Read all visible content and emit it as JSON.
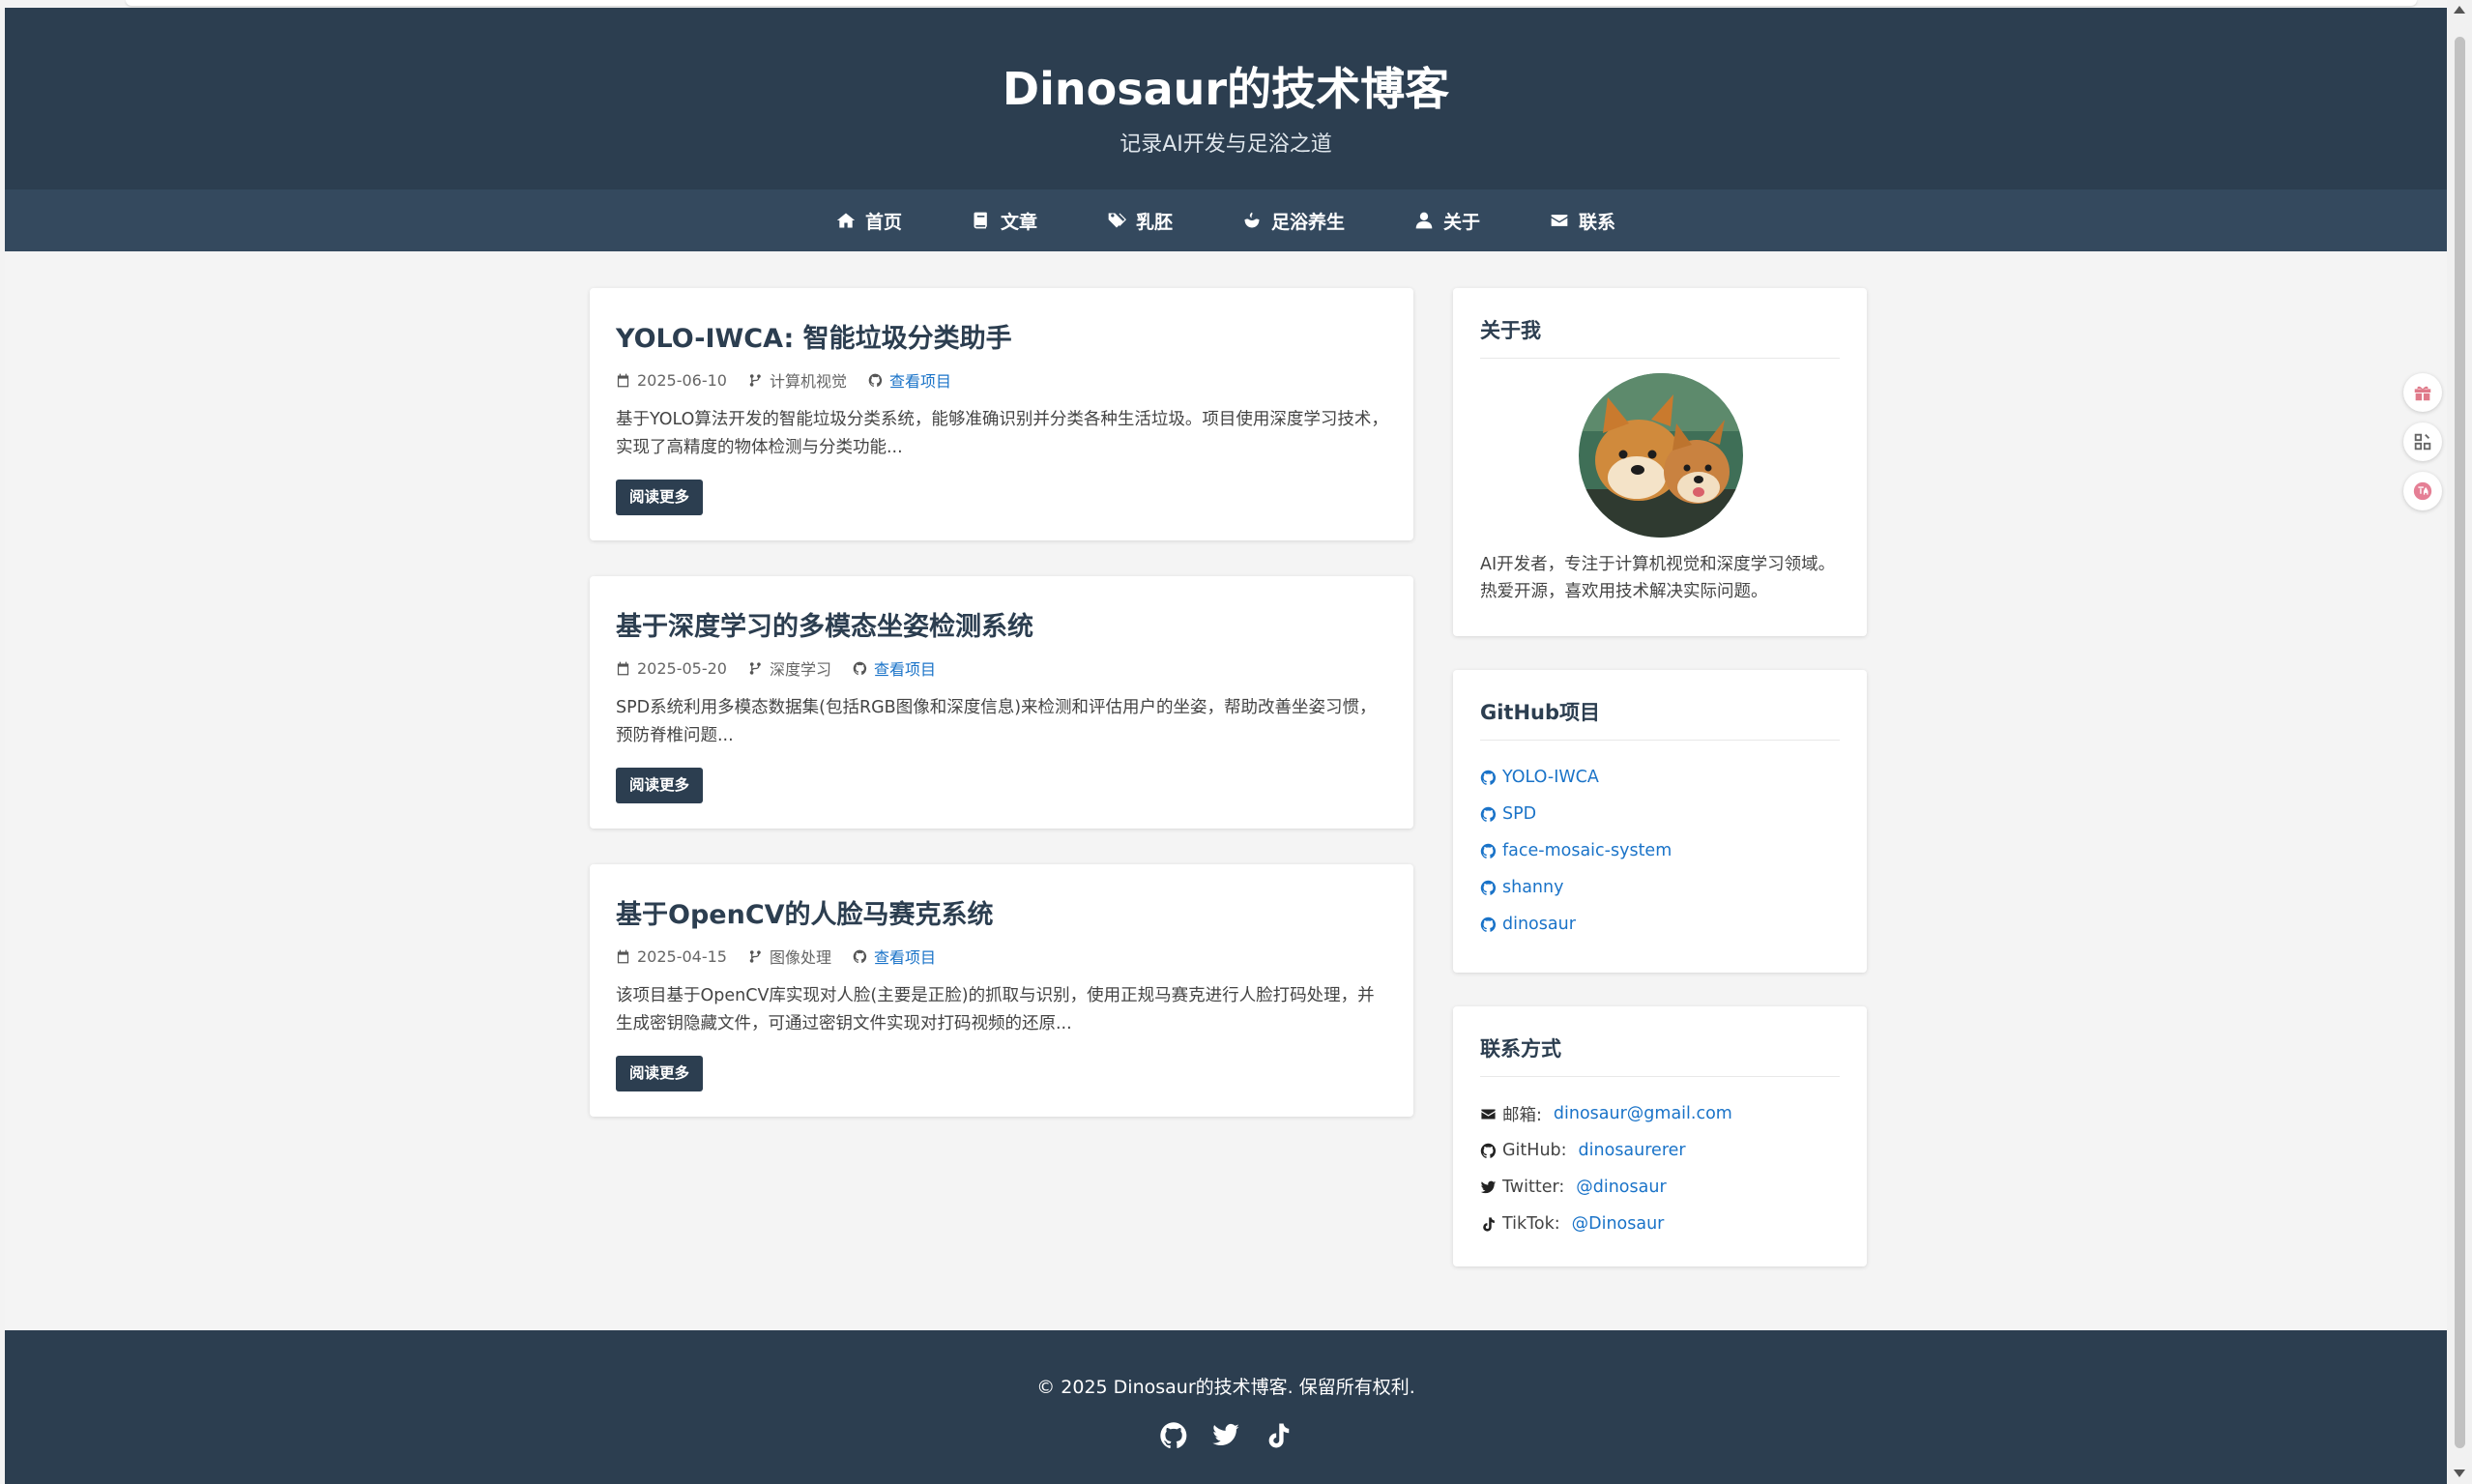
{
  "header": {
    "title": "Dinosaur的技术博客",
    "subtitle": "记录AI开发与足浴之道"
  },
  "nav": [
    {
      "label": "首页",
      "icon": "home-icon"
    },
    {
      "label": "文章",
      "icon": "book-icon"
    },
    {
      "label": "乳胚",
      "icon": "tags-icon"
    },
    {
      "label": "足浴养生",
      "icon": "foot-bath-icon"
    },
    {
      "label": "关于",
      "icon": "user-icon"
    },
    {
      "label": "联系",
      "icon": "envelope-icon"
    }
  ],
  "posts": [
    {
      "title": "YOLO-IWCA: 智能垃圾分类助手",
      "date": "2025-06-10",
      "category": "计算机视觉",
      "project_link": "查看项目",
      "excerpt": "基于YOLO算法开发的智能垃圾分类系统，能够准确识别并分类各种生活垃圾。项目使用深度学习技术，实现了高精度的物体检测与分类功能...",
      "read_more": "阅读更多"
    },
    {
      "title": "基于深度学习的多模态坐姿检测系统",
      "date": "2025-05-20",
      "category": "深度学习",
      "project_link": "查看项目",
      "excerpt": "SPD系统利用多模态数据集(包括RGB图像和深度信息)来检测和评估用户的坐姿，帮助改善坐姿习惯，预防脊椎问题...",
      "read_more": "阅读更多"
    },
    {
      "title": "基于OpenCV的人脸马赛克系统",
      "date": "2025-04-15",
      "category": "图像处理",
      "project_link": "查看项目",
      "excerpt": "该项目基于OpenCV库实现对人脸(主要是正脸)的抓取与识别，使用正规马赛克进行人脸打码处理，并生成密钥隐藏文件，可通过密钥文件实现对打码视频的还原...",
      "read_more": "阅读更多"
    }
  ],
  "about": {
    "title": "关于我",
    "text": "AI开发者，专注于计算机视觉和深度学习领域。热爱开源，喜欢用技术解决实际问题。"
  },
  "github": {
    "title": "GitHub项目",
    "items": [
      "YOLO-IWCA",
      "SPD",
      "face-mosaic-system",
      "shanny",
      "dinosaur"
    ]
  },
  "contact": {
    "title": "联系方式",
    "items": [
      {
        "label": "邮箱:",
        "value": "dinosaur@gmail.com",
        "icon": "envelope-icon"
      },
      {
        "label": "GitHub:",
        "value": "dinosaurerer",
        "icon": "github-icon"
      },
      {
        "label": "Twitter:",
        "value": "@dinosaur",
        "icon": "twitter-icon"
      },
      {
        "label": "TikTok:",
        "value": "@Dinosaur",
        "icon": "tiktok-icon"
      }
    ]
  },
  "footer": {
    "copyright": "© 2025 Dinosaur的技术博客. 保留所有权利."
  },
  "colors": {
    "header_bg": "#2c3e50",
    "nav_bg": "#34495e",
    "link": "#1a73c8"
  }
}
